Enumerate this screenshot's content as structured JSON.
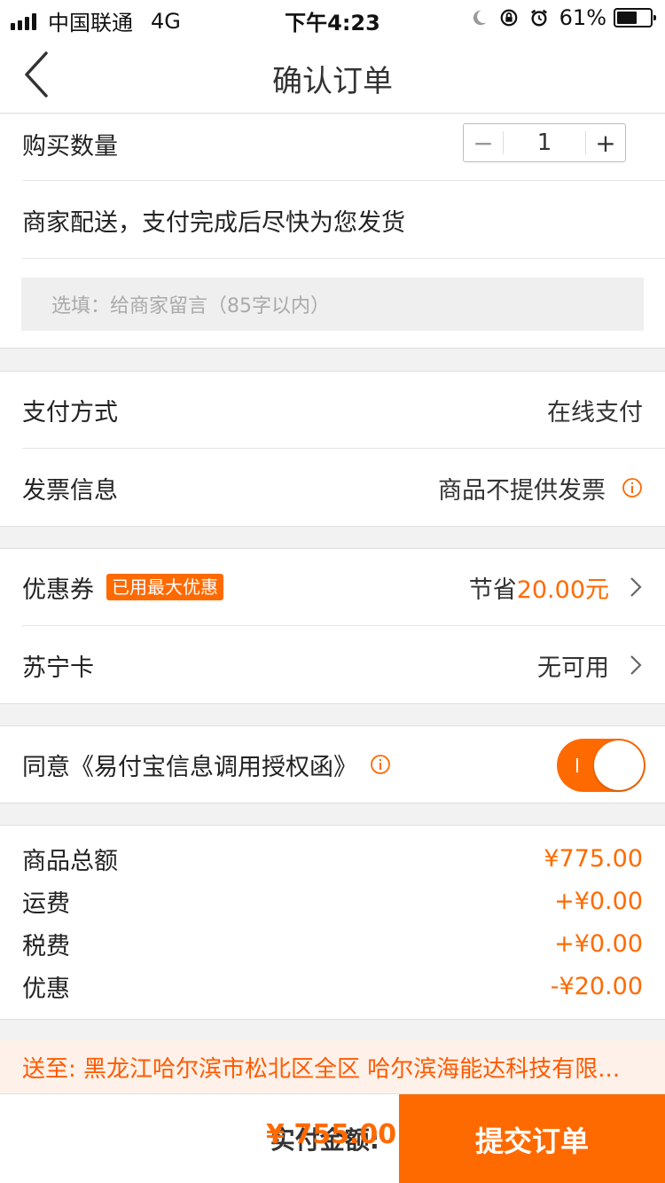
{
  "status_bar": {
    "carrier": "中国联通",
    "network": "4G",
    "time": "下午4:23",
    "battery_percent_text": "61%",
    "battery_level": 0.61
  },
  "nav": {
    "title": "确认订单"
  },
  "quantity": {
    "label": "购买数量",
    "value": "1",
    "minus": "−",
    "plus": "+"
  },
  "delivery": {
    "text": "商家配送，支付完成后尽快为您发货"
  },
  "note": {
    "placeholder": "选填：给商家留言（85字以内）"
  },
  "payment": {
    "label": "支付方式",
    "value": "在线支付"
  },
  "invoice": {
    "label": "发票信息",
    "value": "商品不提供发票"
  },
  "coupon": {
    "label": "优惠券",
    "badge": "已用最大优惠",
    "save_prefix": "节省",
    "save_amount": "20.00元"
  },
  "suning_card": {
    "label": "苏宁卡",
    "value": "无可用"
  },
  "agreement": {
    "label": "同意《易付宝信息调用授权函》",
    "enabled": true
  },
  "summary": [
    {
      "label": "商品总额",
      "value": "¥775.00"
    },
    {
      "label": "运费",
      "value": "+¥0.00"
    },
    {
      "label": "税费",
      "value": "+¥0.00"
    },
    {
      "label": "优惠",
      "value": "-¥20.00"
    }
  ],
  "address": {
    "text": "送至: 黑龙江哈尔滨市松北区全区 哈尔滨海能达科技有限..."
  },
  "bottom": {
    "pay_label": "实付金额:",
    "pay_amount": "¥ 755.00",
    "submit_label": "提交订单"
  },
  "colors": {
    "accent": "#ff6a00",
    "address_bg": "#fdf1e9"
  }
}
